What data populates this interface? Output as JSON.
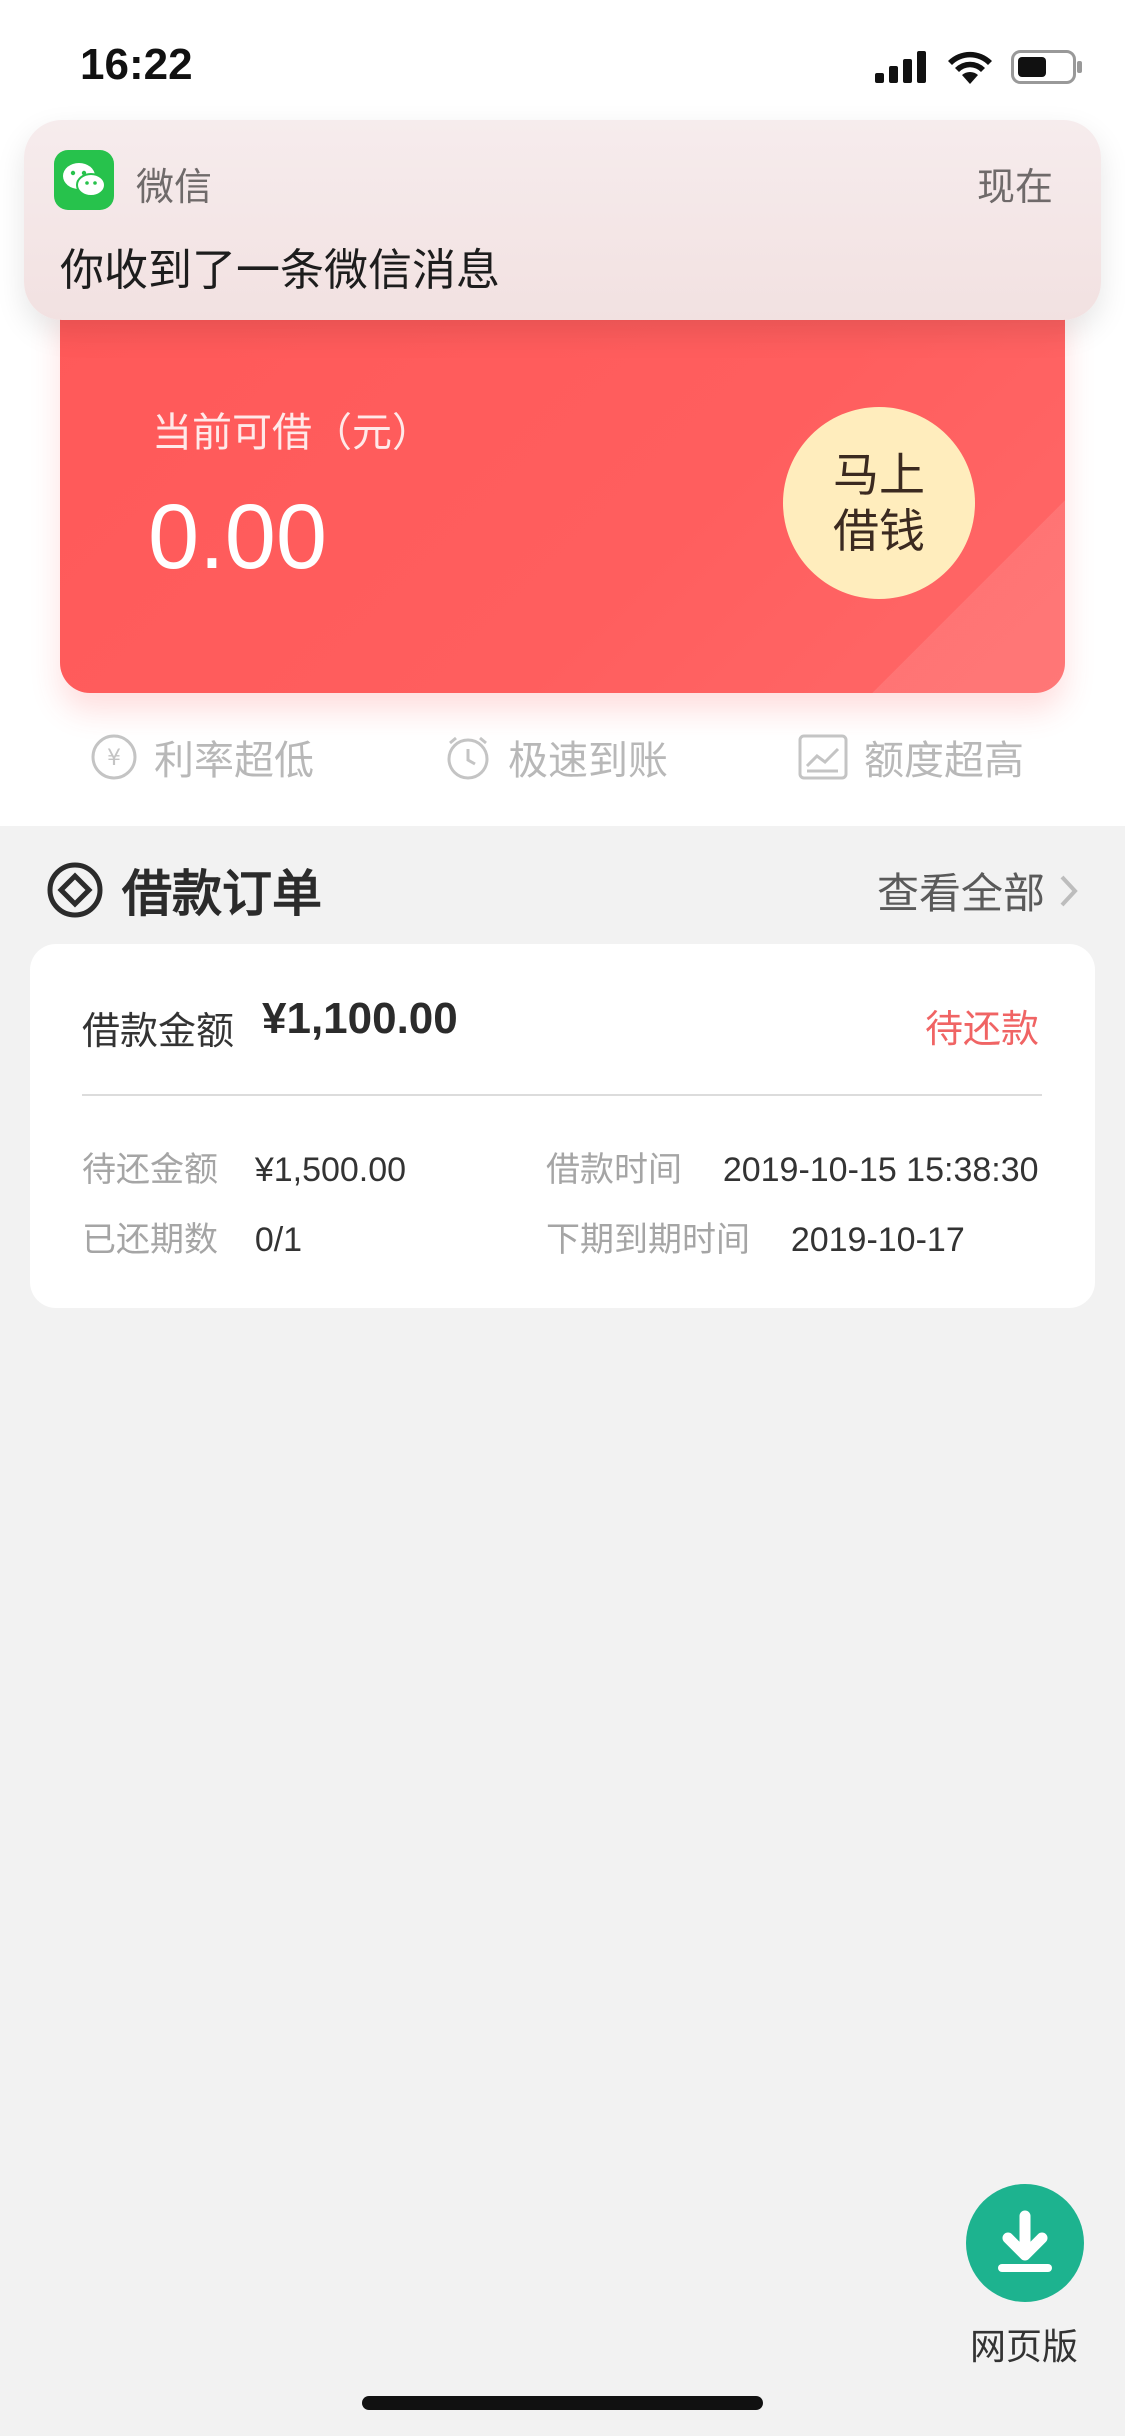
{
  "status_bar": {
    "time": "16:22"
  },
  "notification": {
    "app_name": "微信",
    "time": "现在",
    "message": "你收到了一条微信消息"
  },
  "loan_card": {
    "label": "当前可借（元）",
    "amount": "0.00",
    "borrow_button_line1": "马上",
    "borrow_button_line2": "借钱"
  },
  "features": [
    {
      "label": "利率超低",
      "icon": "yen-circle-icon"
    },
    {
      "label": "极速到账",
      "icon": "clock-icon"
    },
    {
      "label": "额度超高",
      "icon": "chart-icon"
    }
  ],
  "orders": {
    "title": "借款订单",
    "view_all": "查看全部",
    "card": {
      "amount_label": "借款金额",
      "amount": "¥1,100.00",
      "status": "待还款",
      "pending_label": "待还金额",
      "pending_value": "¥1,500.00",
      "time_label": "借款时间",
      "time_value": "2019-10-15 15:38:30",
      "periods_label": "已还期数",
      "periods_value": "0/1",
      "due_label": "下期到期时间",
      "due_value": "2019-10-17"
    }
  },
  "download": {
    "label": "网页版"
  },
  "colors": {
    "card_red": "#ff5b5b",
    "borrow_button": "#ffedbd",
    "status_red": "#f06464",
    "download_green": "#1db38f"
  }
}
